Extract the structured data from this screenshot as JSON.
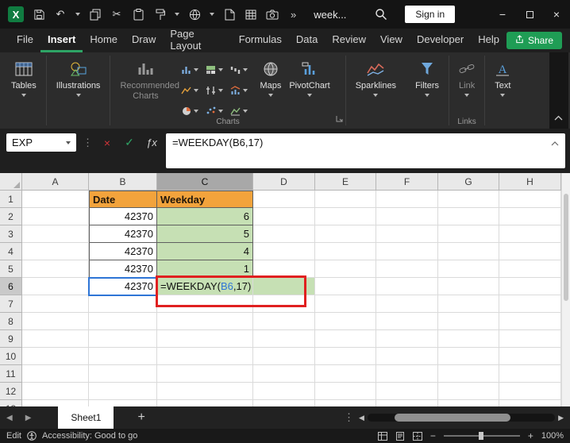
{
  "colors": {
    "accent_green": "#1f9d55",
    "tab_underline": "#2ea465",
    "orange_header_fill": "#f2a33c",
    "green_cell_fill": "#c6e0b4",
    "reference_blue": "#2e75d6",
    "annotation_red": "#e02020"
  },
  "titlebar": {
    "search_text": "week...",
    "sign_in_label": "Sign in",
    "more_commands": "»"
  },
  "tabs": {
    "items": [
      {
        "label": "File",
        "active": false
      },
      {
        "label": "Insert",
        "active": true
      },
      {
        "label": "Home",
        "active": false
      },
      {
        "label": "Draw",
        "active": false
      },
      {
        "label": "Page Layout",
        "active": false
      },
      {
        "label": "Formulas",
        "active": false
      },
      {
        "label": "Data",
        "active": false
      },
      {
        "label": "Review",
        "active": false
      },
      {
        "label": "View",
        "active": false
      },
      {
        "label": "Developer",
        "active": false
      },
      {
        "label": "Help",
        "active": false
      }
    ],
    "share_label": "Share"
  },
  "ribbon": {
    "tables_label": "Tables",
    "illustrations_label": "Illustrations",
    "recommended_charts_label": "Recommended Charts",
    "charts_group_label": "Charts",
    "maps_label": "Maps",
    "pivotchart_label": "PivotChart",
    "sparklines_label": "Sparklines",
    "filters_label": "Filters",
    "link_label": "Link",
    "links_group_label": "Links",
    "text_label": "Text"
  },
  "formula_bar": {
    "name_box": "EXP",
    "formula": "=WEEKDAY(B6,17)"
  },
  "grid": {
    "columns": [
      "A",
      "B",
      "C",
      "D",
      "E",
      "F",
      "G",
      "H"
    ],
    "selected_column": "C",
    "selected_row": 6,
    "row_count": 12,
    "cells": [
      {
        "ref": "B1",
        "text": "Date",
        "style": "orange-header"
      },
      {
        "ref": "C1",
        "text": "Weekday",
        "style": "orange-header"
      },
      {
        "ref": "B2",
        "text": "42370",
        "style": "table-num"
      },
      {
        "ref": "B3",
        "text": "42370",
        "style": "table-num"
      },
      {
        "ref": "B4",
        "text": "42370",
        "style": "table-num"
      },
      {
        "ref": "B5",
        "text": "42370",
        "style": "table-num"
      },
      {
        "ref": "B6",
        "text": "42370",
        "style": "table-num"
      },
      {
        "ref": "C2",
        "text": "6",
        "style": "green-num"
      },
      {
        "ref": "C3",
        "text": "5",
        "style": "green-num"
      },
      {
        "ref": "C4",
        "text": "4",
        "style": "green-num"
      },
      {
        "ref": "C5",
        "text": "1",
        "style": "green-num"
      },
      {
        "ref": "C6",
        "text": "",
        "style": "formula-cell"
      },
      {
        "ref": "D6",
        "text": "",
        "style": "green-spill"
      }
    ],
    "formula_cell": {
      "ref": "C6",
      "prefix": "=WEEKDAY(",
      "cell_ref": "B6",
      "suffix": ",17)"
    }
  },
  "sheet_bar": {
    "active_tab": "Sheet1",
    "add_sheet": "+"
  },
  "status_bar": {
    "mode": "Edit",
    "accessibility": "Accessibility: Good to go",
    "zoom": "100%"
  }
}
